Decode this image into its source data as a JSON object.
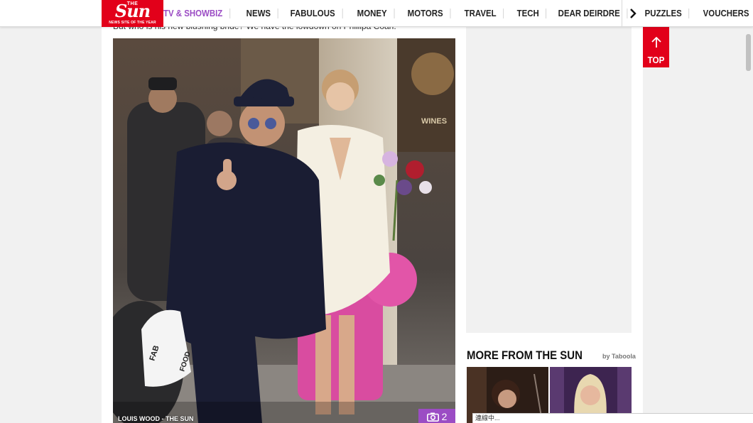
{
  "header": {
    "logo_the": "THE",
    "logo_sun": "Sun",
    "logo_tagline": "NEWS SITE OF THE YEAR",
    "nav": [
      {
        "label": "TV & SHOWBIZ",
        "active": true
      },
      {
        "label": "NEWS"
      },
      {
        "label": "FABULOUS"
      },
      {
        "label": "MONEY"
      },
      {
        "label": "MOTORS"
      },
      {
        "label": "TRAVEL"
      },
      {
        "label": "TECH"
      },
      {
        "label": "DEAR DEIRDRE"
      },
      {
        "label": "PUZZLES"
      },
      {
        "label": "VOUCHERS"
      }
    ],
    "next_icon": "chevron-right-icon"
  },
  "article": {
    "intro_text": "But who is his new blushing bride? We have the lowdown on Phillipa Coan.",
    "photo_credit": "LOUIS WOOD - THE SUN",
    "gallery_count": "2",
    "gallery_icon": "camera-icon",
    "shop_sign": "WINES"
  },
  "sidebar": {
    "top_button_label": "TOP",
    "more_heading": "MORE FROM THE SUN",
    "sponsor": "by Taboola"
  },
  "status": {
    "loading_text": "連線中..."
  },
  "colors": {
    "brand_red": "#e2001a",
    "accent_purple": "#9b4cc4"
  }
}
